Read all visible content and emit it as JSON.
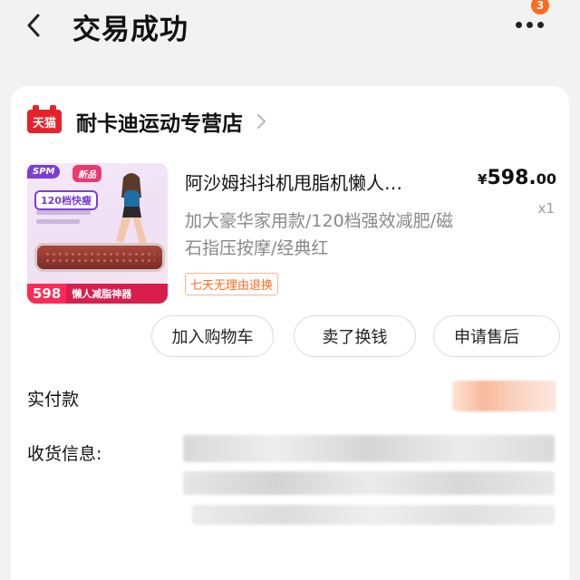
{
  "header": {
    "title": "交易成功",
    "message_badge": "3"
  },
  "store": {
    "logo_text": "天猫",
    "name": "耐卡迪运动专营店"
  },
  "product": {
    "title": "阿沙姆抖抖机甩脂机懒人…",
    "spec": "加大豪华家用款/120档强效减肥/磁石指压按摩/经典红",
    "price_currency": "¥",
    "price_integer": "598.",
    "price_decimal": "00",
    "quantity": "x1",
    "return_tag": "七天无理由退换",
    "thumb": {
      "tag1": "SPM",
      "tag2": "新品",
      "gear": "120档快瘦",
      "price": "598",
      "slogan": "懒人减脂神器"
    }
  },
  "actions": {
    "add_to_cart": "加入购物车",
    "resell": "卖了换钱",
    "refund": "申请售后"
  },
  "info": {
    "paid_label": "实付款",
    "address_label": "收货信息:"
  },
  "colors": {
    "accent": "#ff6a1f",
    "tmall_red": "#e5222a",
    "background": "#f2f2f2"
  },
  "icons": {
    "back": "chevron-left-icon",
    "more": "more-dots-icon",
    "store_chevron": "chevron-right-icon"
  }
}
